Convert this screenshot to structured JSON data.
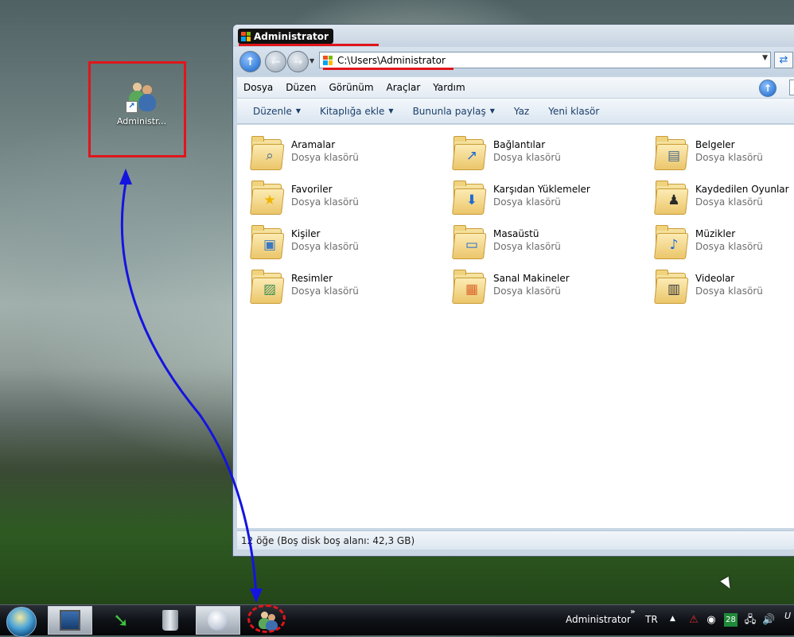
{
  "desktop": {
    "icon_label": "Administr..."
  },
  "window": {
    "title": "Administrator",
    "address": "C:\\Users\\Administrator",
    "menu": [
      "Dosya",
      "Düzen",
      "Görünüm",
      "Araçlar",
      "Yardım"
    ],
    "commands": [
      "Düzenle",
      "Kitaplığa ekle",
      "Bununla paylaş",
      "Yaz",
      "Yeni klasör"
    ],
    "items": [
      {
        "name": "Aramalar",
        "type": "Dosya klasörü",
        "emblem": "magnifier-icon"
      },
      {
        "name": "Bağlantılar",
        "type": "Dosya klasörü",
        "emblem": "arrow-icon"
      },
      {
        "name": "Belgeler",
        "type": "Dosya klasörü",
        "emblem": "document-icon"
      },
      {
        "name": "Favoriler",
        "type": "Dosya klasörü",
        "emblem": "star-icon"
      },
      {
        "name": "Karşıdan Yüklemeler",
        "type": "Dosya klasörü",
        "emblem": "download-icon"
      },
      {
        "name": "Kaydedilen Oyunlar",
        "type": "Dosya klasörü",
        "emblem": "chess-icon"
      },
      {
        "name": "Kişiler",
        "type": "Dosya klasörü",
        "emblem": "contact-icon"
      },
      {
        "name": "Masaüstü",
        "type": "Dosya klasörü",
        "emblem": "monitor-icon"
      },
      {
        "name": "Müzikler",
        "type": "Dosya klasörü",
        "emblem": "music-icon"
      },
      {
        "name": "Resimler",
        "type": "Dosya klasörü",
        "emblem": "picture-icon"
      },
      {
        "name": "Sanal Makineler",
        "type": "Dosya klasörü",
        "emblem": "virtual-machine-icon"
      },
      {
        "name": "Videolar",
        "type": "Dosya klasörü",
        "emblem": "film-icon"
      }
    ],
    "status": "12 öğe (Boş disk boş alanı: 42,3 GB)"
  },
  "taskbar": {
    "tray_user": "Administrator",
    "tray_chevron": "»",
    "language": "TR",
    "badge": "28",
    "clock_fragment": "U"
  },
  "colors": {
    "annotation_red": "#e0161b",
    "annotation_blue": "#1414e0"
  }
}
